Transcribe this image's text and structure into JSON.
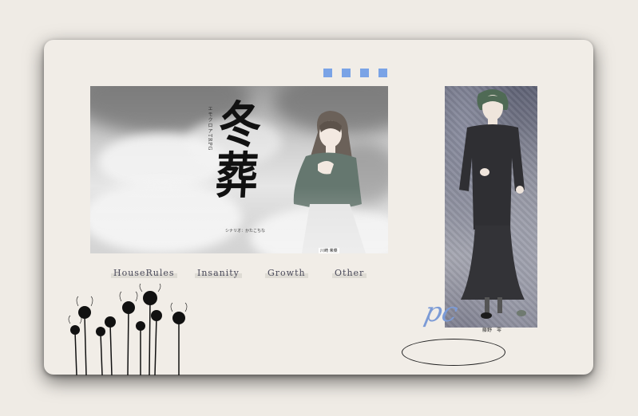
{
  "banner": {
    "title_small": "エモクロアTRPG",
    "title_main": "冬葬",
    "title_sub": "シナリオ：かたこちな",
    "character_name": "川崎 茉菜"
  },
  "portrait": {
    "character_name": "藤野　零"
  },
  "nav": {
    "items": [
      {
        "label": "HouseRules"
      },
      {
        "label": "Insanity"
      },
      {
        "label": "Growth"
      },
      {
        "label": "Other"
      }
    ]
  },
  "pc_mark": "pc",
  "colors": {
    "accent": "#7aa3e6",
    "background": "#f1ede7",
    "outer": "#efebe5"
  }
}
